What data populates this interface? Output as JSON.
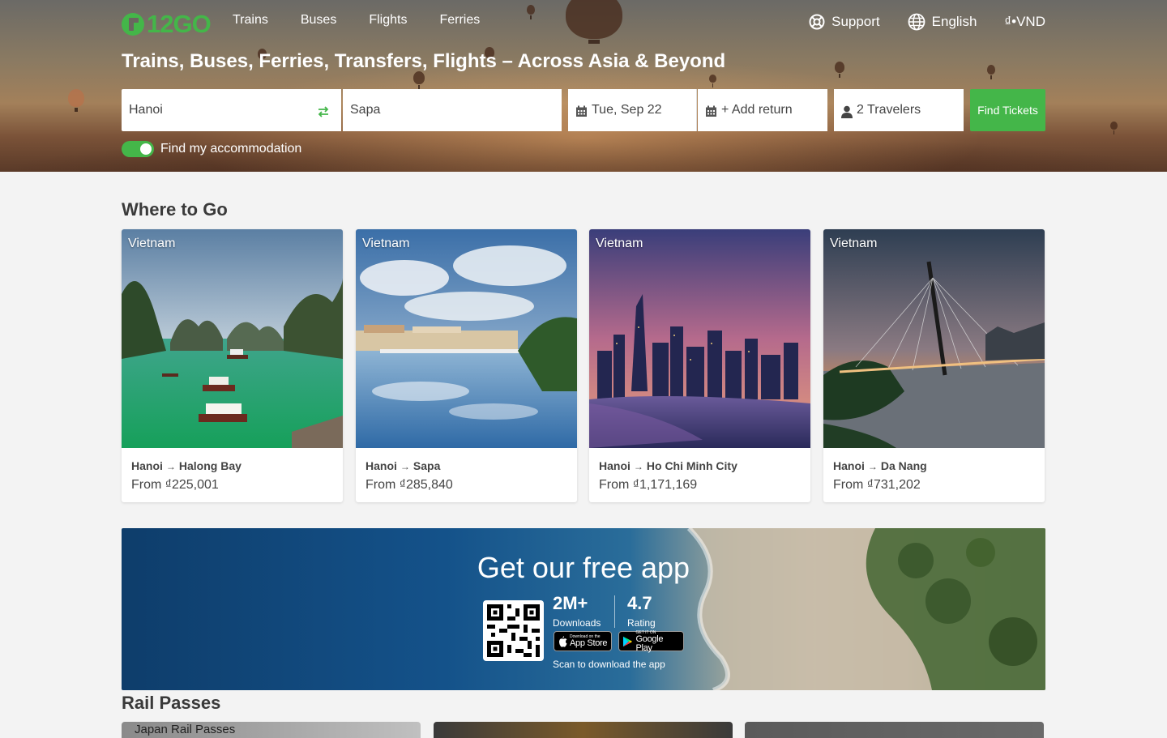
{
  "brand": {
    "logo_text": "12GO"
  },
  "nav": {
    "items": [
      "Trains",
      "Buses",
      "Flights",
      "Ferries"
    ]
  },
  "topright": {
    "support": "Support",
    "language": "English",
    "currency": "₫•VND"
  },
  "hero": {
    "headline": "Trains, Buses, Ferries, Transfers, Flights – Across Asia & Beyond"
  },
  "search": {
    "from": "Hanoi",
    "to": "Sapa",
    "date": "Tue, Sep 22",
    "return": "+ Add return",
    "travelers": "2 Travelers",
    "button": "Find Tickets",
    "accommodation_label": "Find my accommodation",
    "accommodation_on": true
  },
  "where_to_go": {
    "title": "Where to Go",
    "cards": [
      {
        "country": "Vietnam",
        "from_city": "Hanoi",
        "to_city": "Halong Bay",
        "price": "From ₫225,001"
      },
      {
        "country": "Vietnam",
        "from_city": "Hanoi",
        "to_city": "Sapa",
        "price": "From ₫285,840"
      },
      {
        "country": "Vietnam",
        "from_city": "Hanoi",
        "to_city": "Ho Chi Minh City",
        "price": "From ₫1,171,169"
      },
      {
        "country": "Vietnam",
        "from_city": "Hanoi",
        "to_city": "Da Nang",
        "price": "From ₫731,202"
      }
    ],
    "arrow": "→"
  },
  "app": {
    "title": "Get our free app",
    "downloads_value": "2M+",
    "downloads_label": "Downloads",
    "rating_value": "4.7",
    "rating_label": "Rating",
    "app_store_small": "Download on the",
    "app_store_large": "App Store",
    "google_play_small": "GET IT ON",
    "google_play_large": "Google Play",
    "scan_text": "Scan to download the app"
  },
  "rail_passes": {
    "title": "Rail Passes",
    "cards": [
      "Japan Rail Passes",
      "",
      ""
    ]
  },
  "colors": {
    "brand_green": "#44b649",
    "banner_blue": "#14528a"
  }
}
